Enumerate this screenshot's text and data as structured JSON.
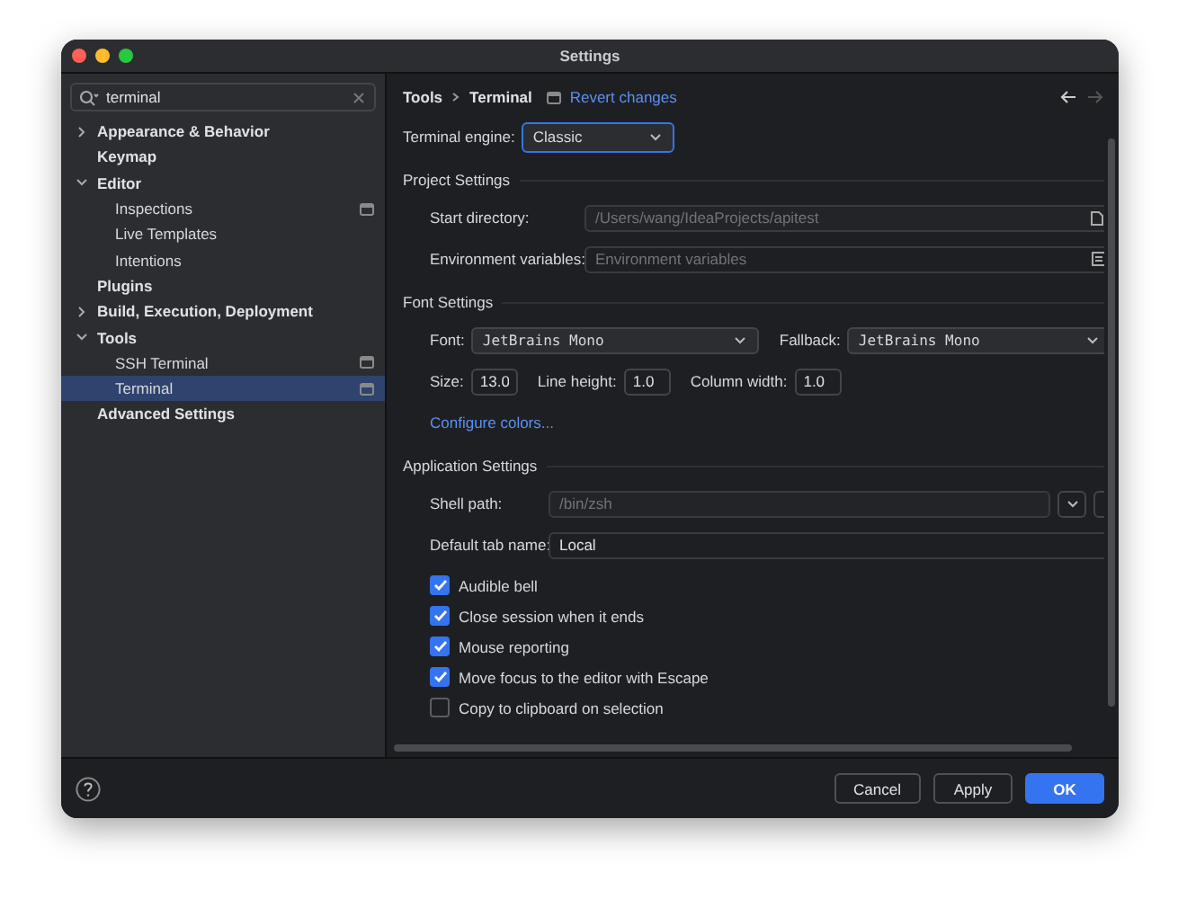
{
  "window": {
    "title": "Settings"
  },
  "search": {
    "value": "terminal"
  },
  "tree": [
    {
      "label": "Appearance & Behavior",
      "expanded": false
    },
    {
      "label": "Keymap"
    },
    {
      "label": "Editor",
      "expanded": true,
      "children": [
        {
          "label": "Inspections",
          "project_icon": true,
          "selected": false
        },
        {
          "label": "Live Templates",
          "project_icon": false,
          "selected": false
        },
        {
          "label": "Intentions",
          "project_icon": false,
          "selected": false
        }
      ]
    },
    {
      "label": "Plugins"
    },
    {
      "label": "Build, Execution, Deployment",
      "expanded": false
    },
    {
      "label": "Tools",
      "expanded": true,
      "children": [
        {
          "label": "SSH Terminal",
          "project_icon": true,
          "selected": false
        },
        {
          "label": "Terminal",
          "project_icon": true,
          "selected": true
        }
      ]
    },
    {
      "label": "Advanced Settings"
    }
  ],
  "breadcrumb": [
    "Tools",
    "Terminal"
  ],
  "revert": "Revert changes",
  "engine": {
    "label": "Terminal engine:",
    "value": "Classic"
  },
  "project": {
    "title": "Project Settings",
    "start_label": "Start directory:",
    "start_value": "/Users/wang/IdeaProjects/apitest",
    "env_label": "Environment variables:",
    "env_placeholder": "Environment variables"
  },
  "font": {
    "title": "Font Settings",
    "font_label": "Font:",
    "font_value": "JetBrains Mono",
    "fallback_label": "Fallback:",
    "fallback_value": "JetBrains Mono",
    "size_label": "Size:",
    "size": "13.0",
    "lh_label": "Line height:",
    "lh": "1.0",
    "cw_label": "Column width:",
    "cw": "1.0",
    "link": "Configure colors..."
  },
  "app": {
    "title": "Application Settings",
    "shell_label": "Shell path:",
    "shell_value": "/bin/zsh",
    "tab_label": "Default tab name:",
    "tab_value": "Local",
    "options": [
      {
        "label": "Audible bell",
        "checked": true
      },
      {
        "label": "Close session when it ends",
        "checked": true
      },
      {
        "label": "Mouse reporting",
        "checked": true
      },
      {
        "label": "Move focus to the editor with Escape",
        "checked": true
      },
      {
        "label": "Copy to clipboard on selection",
        "checked": false
      }
    ]
  },
  "buttons": [
    {
      "label": "Cancel",
      "kind": "normal"
    },
    {
      "label": "Apply",
      "kind": "normal"
    },
    {
      "label": "OK",
      "kind": "primary"
    }
  ]
}
